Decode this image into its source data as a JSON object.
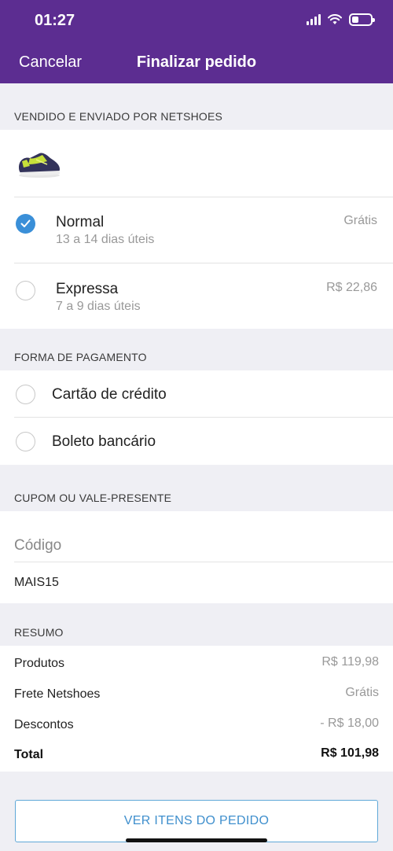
{
  "status_bar": {
    "time": "01:27"
  },
  "nav": {
    "cancel_label": "Cancelar",
    "title": "Finalizar pedido"
  },
  "seller": {
    "label": "VENDIDO E ENVIADO POR NETSHOES",
    "product_image": "sneaker-thumbnail"
  },
  "shipping": {
    "options": [
      {
        "name": "Normal",
        "eta": "13 a 14 dias úteis",
        "price": "Grátis",
        "selected": true
      },
      {
        "name": "Expressa",
        "eta": "7 a 9 dias úteis",
        "price": "R$ 22,86",
        "selected": false
      }
    ]
  },
  "payment": {
    "label": "FORMA DE PAGAMENTO",
    "options": [
      {
        "name": "Cartão de crédito",
        "selected": false
      },
      {
        "name": "Boleto bancário",
        "selected": false
      }
    ]
  },
  "coupon": {
    "label": "CUPOM OU VALE-PRESENTE",
    "placeholder": "Código",
    "value": "MAIS15"
  },
  "summary": {
    "label": "RESUMO",
    "rows": [
      {
        "label": "Produtos",
        "value": "R$ 119,98"
      },
      {
        "label": "Frete Netshoes",
        "value": "Grátis"
      },
      {
        "label": "Descontos",
        "value": "- R$ 18,00"
      }
    ],
    "total_label": "Total",
    "total_value": "R$ 101,98"
  },
  "actions": {
    "view_items_label": "VER ITENS DO PEDIDO"
  },
  "colors": {
    "header": "#5c2d91",
    "accent": "#3a8fd8",
    "button_text": "#3f8fcd"
  }
}
